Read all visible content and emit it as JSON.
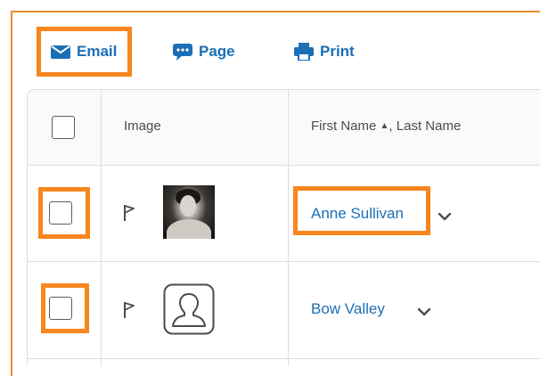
{
  "toolbar": {
    "email_label": "Email",
    "page_label": "Page",
    "print_label": "Print"
  },
  "table": {
    "headers": {
      "image": "Image",
      "first_name": "First Name",
      "sort_indicator": "▲",
      "last_name_sep": ", Last Name"
    },
    "rows": [
      {
        "name": "Anne Sullivan",
        "flag_icon": "flag-icon",
        "image": "user-photo"
      },
      {
        "name": "Bow Valley",
        "flag_icon": "flag-icon",
        "image": "default-avatar-icon"
      }
    ]
  },
  "colors": {
    "highlight": "#f7861f",
    "link": "#1b6fb5",
    "border": "#d9dde2"
  }
}
